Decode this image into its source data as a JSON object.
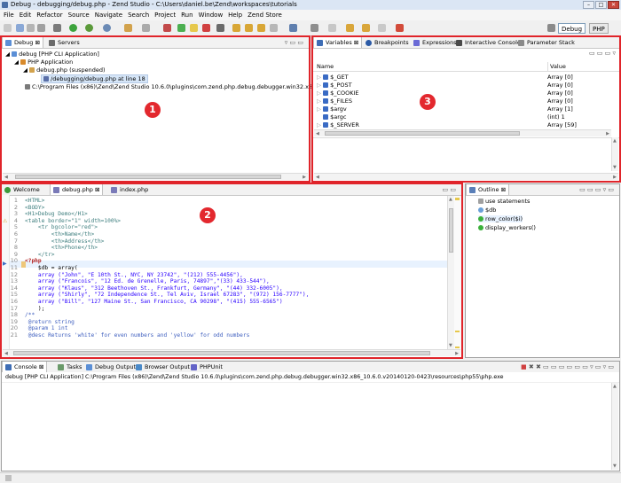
{
  "window": {
    "title": "Debug - debugging/debug.php - Zend Studio - C:\\Users\\daniel.be\\Zend\\workspaces\\tutorials"
  },
  "menu": [
    "File",
    "Edit",
    "Refactor",
    "Source",
    "Navigate",
    "Search",
    "Project",
    "Run",
    "Window",
    "Help",
    "Zend Store"
  ],
  "perspectives": {
    "debug": "Debug",
    "php": "PHP"
  },
  "debug_panel": {
    "tabs": [
      "Debug",
      "Servers"
    ],
    "tree": [
      "debug [PHP CLI Application]",
      "PHP Application",
      "debug.php (suspended)",
      "/debugging/debug.php at line 18",
      "C:\\Program Files (x86)\\Zend\\Zend Studio 10.6.0\\plugins\\com.zend.php.debug.debugger.win32.x86_10.6.0.v"
    ],
    "badge": "1"
  },
  "variables_panel": {
    "tabs": [
      "Variables",
      "Breakpoints",
      "Expressions",
      "Interactive Console",
      "Parameter Stack"
    ],
    "headers": {
      "name": "Name",
      "value": "Value"
    },
    "rows": [
      {
        "name": "$_GET",
        "value": "Array [0]"
      },
      {
        "name": "$_POST",
        "value": "Array [0]"
      },
      {
        "name": "$_COOKIE",
        "value": "Array [0]"
      },
      {
        "name": "$_FILES",
        "value": "Array [0]"
      },
      {
        "name": "$argv",
        "value": "Array [1]"
      },
      {
        "name": "$argc",
        "value": "(int) 1"
      },
      {
        "name": "$_SERVER",
        "value": "Array [59]"
      }
    ],
    "badge": "3"
  },
  "editor": {
    "tabs": [
      "Welcome",
      "debug.php",
      "index.php"
    ],
    "badge": "2",
    "line_numbers": [
      "1",
      "2",
      "3",
      "4",
      "5",
      "6",
      "7",
      "8",
      "9",
      "10",
      "11",
      "12",
      "13",
      "14",
      "15",
      "16",
      "17",
      "18",
      "19",
      "20",
      "21"
    ],
    "lines": [
      "<HTML>",
      "<BODY>",
      "<H1>Debug Demo</H1>",
      "<table border=\"1\" width=100%>",
      "    <tr bgcolor=\"red\">",
      "        <th>Name</th>",
      "        <th>Address</th>",
      "        <th>Phone</th>",
      "    </tr>",
      "<?php",
      "    $db = array(",
      "    array (\"John\", \"E 10th St., NYC, NY 23742\", \"(212) 555-4456\"),",
      "    array (\"Francois\", \"12 Ed. de Grenelle, Paris, 74897\",\"(33) 433-544\"),",
      "    array (\"Klaus\", \"312 Beethoven St., Frankfurt, Germany\", \"(44) 332-6005\"),",
      "    array (\"Shirly\", \"72 Independence St., Tel Aviv, Israel 67283\", \"(972) 156-7777\"),",
      "    array (\"Bill\", \"127 Maine St., San Francisco, CA 90298\", \"(415) 555-6565\")",
      "    );",
      "/**",
      " @return string",
      " @param 1 int",
      " @desc Returns 'white' for even numbers and 'yellow' for odd numbers"
    ]
  },
  "outline": {
    "tab": "Outline",
    "items": [
      "use statements",
      "$db",
      "row_color($i)",
      "display_workers()"
    ]
  },
  "console": {
    "tabs": [
      "Console",
      "Tasks",
      "Debug Output",
      "Browser Output",
      "PHPUnit"
    ],
    "text": "debug [PHP CLI Application] C:\\Program Files (x86)\\Zend\\Zend Studio 10.6.0\\plugins\\com.zend.php.debug.debugger.win32.x86_10.6.0.v20140120-0423\\resources\\php55\\php.exe"
  },
  "colors": {
    "highlight": "#e3282e",
    "keyword": "#7f0055",
    "string": "#2a00ff",
    "selection": "#e8f2fe"
  }
}
